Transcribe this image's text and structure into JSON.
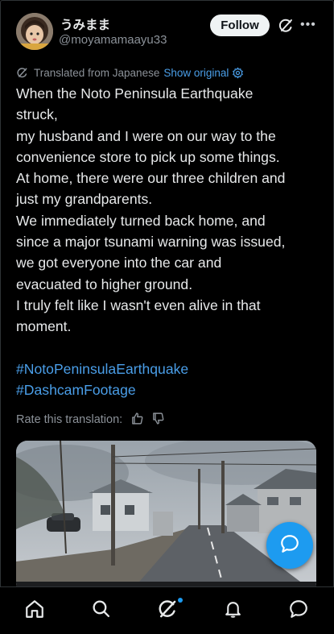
{
  "author": {
    "display_name": "うみまま",
    "handle": "@moyamamaayu33"
  },
  "actions": {
    "follow_label": "Follow"
  },
  "translation": {
    "notice": "Translated from Japanese",
    "show_original": "Show original"
  },
  "post": {
    "lines": [
      "When the Noto Peninsula Earthquake",
      "struck,",
      "my husband and I were on our way to the",
      "convenience store to pick up some things.",
      "At home, there were our three children and",
      "just my grandparents.",
      "We immediately turned back home, and",
      "since a major tsunami warning was issued,",
      "we got everyone into the car and",
      "evacuated to higher ground.",
      "I truly felt like I wasn't even alive in that",
      "moment."
    ],
    "hashtags": [
      "#NotoPeninsulaEarthquake",
      "#DashcamFootage"
    ]
  },
  "rate": {
    "label": "Rate this translation:"
  },
  "colors": {
    "accent": "#1d9bf0",
    "link": "#4a9ee8",
    "background": "#000000",
    "muted": "#8b9198"
  },
  "icons": {
    "translate": "grok-translate-icon",
    "settings": "settings-icon",
    "thumb_up": "thumbs-up-icon",
    "thumb_down": "thumbs-down-icon",
    "compose": "compose-bubble-icon",
    "nav": [
      "home-icon",
      "search-icon",
      "grok-icon",
      "notifications-icon",
      "messages-icon"
    ]
  }
}
